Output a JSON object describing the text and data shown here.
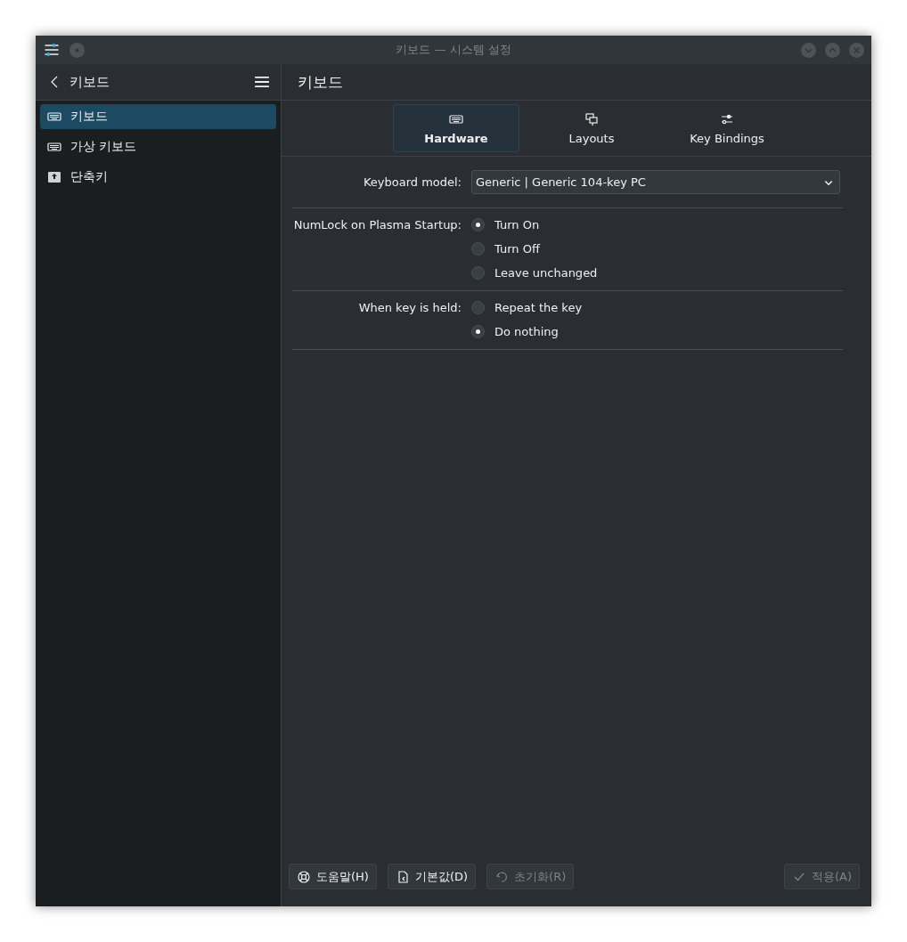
{
  "window": {
    "title": "키보드 — 시스템 설정"
  },
  "sidebar": {
    "title": "키보드",
    "items": [
      {
        "label": "키보드",
        "selected": true
      },
      {
        "label": "가상 키보드",
        "selected": false
      },
      {
        "label": "단축키",
        "selected": false
      }
    ]
  },
  "page": {
    "title": "키보드"
  },
  "tabs": [
    {
      "label": "Hardware",
      "selected": true
    },
    {
      "label": "Layouts",
      "selected": false
    },
    {
      "label": "Key Bindings",
      "selected": false
    }
  ],
  "form": {
    "keyboard_model": {
      "label": "Keyboard model:",
      "value": "Generic | Generic 104-key PC"
    },
    "groups": [
      {
        "label": "NumLock on Plasma Startup:",
        "options": [
          {
            "label": "Turn On",
            "selected": true
          },
          {
            "label": "Turn Off",
            "selected": false
          },
          {
            "label": "Leave unchanged",
            "selected": false
          }
        ]
      },
      {
        "label": "When key is held:",
        "options": [
          {
            "label": "Repeat the key",
            "selected": false
          },
          {
            "label": "Do nothing",
            "selected": true
          }
        ]
      }
    ]
  },
  "buttons": [
    {
      "label": "도움말(H)",
      "disabled": false
    },
    {
      "label": "기본값(D)",
      "disabled": false
    },
    {
      "label": "초기화(R)",
      "disabled": true
    }
  ],
  "apply_button": {
    "label": "적용(A)",
    "disabled": true
  }
}
